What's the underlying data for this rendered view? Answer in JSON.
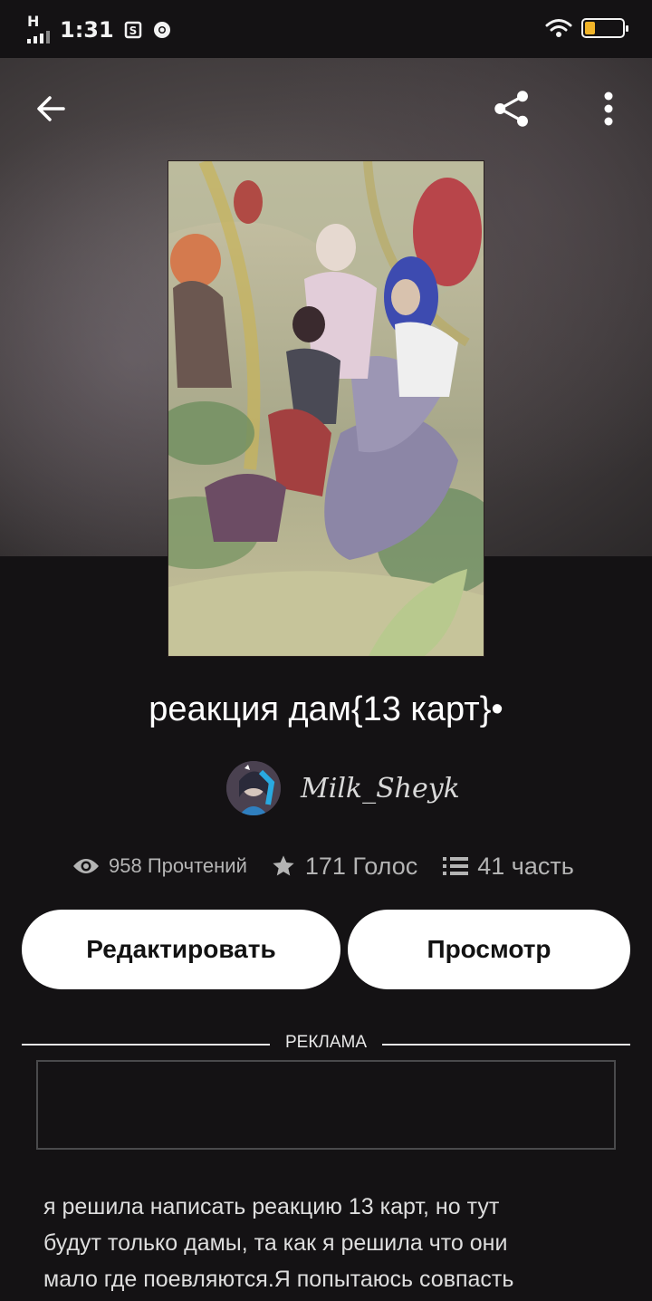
{
  "status_bar": {
    "network_label": "H",
    "time": "1:31",
    "battery_level": 0.25
  },
  "book": {
    "title": "реакция дам{13 карт}•",
    "author": "Milk_Sheyk",
    "reads": "958 Прочтений",
    "votes": "171 Голос",
    "parts": "41 часть"
  },
  "actions": {
    "edit_label": "Редактировать",
    "view_label": "Просмотр"
  },
  "ad": {
    "label": "РЕКЛАМА"
  },
  "description": {
    "lines": [
      "я решила написать реакцию 13 карт, но тут",
      "будут только дамы, та как я решила что они",
      "мало где поевляются.Я попытаюсь совпасть"
    ]
  },
  "icons": {
    "back": "arrow-left-icon",
    "share": "share-icon",
    "more": "more-vertical-icon",
    "reads": "eye-icon",
    "votes": "star-icon",
    "parts": "list-icon"
  }
}
